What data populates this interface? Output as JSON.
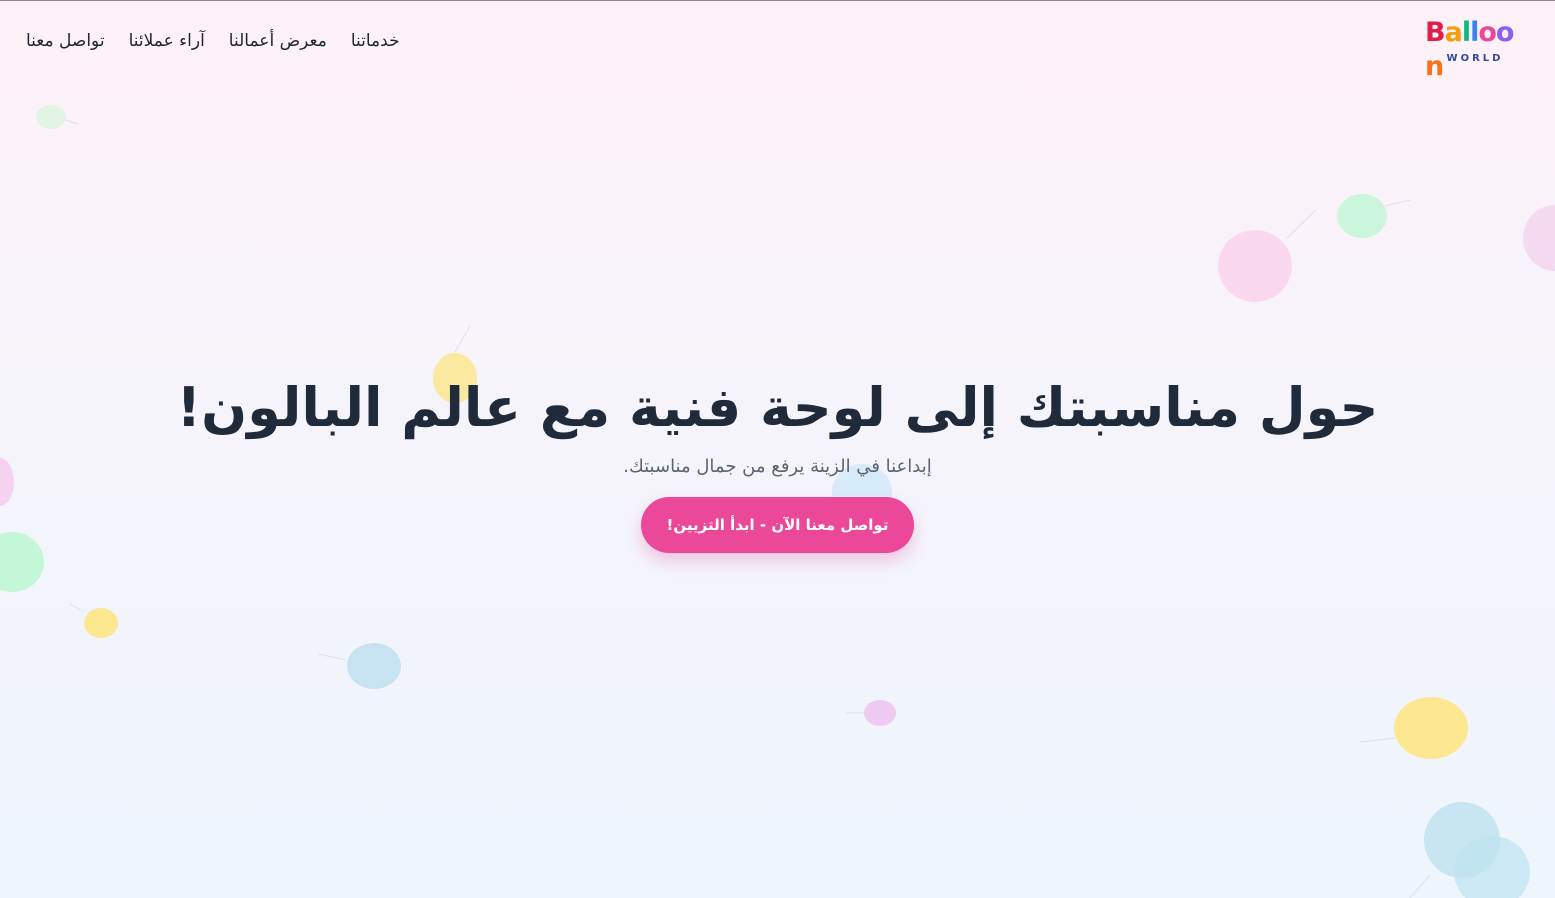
{
  "brand": {
    "logo_letters": [
      "B",
      "a",
      "l",
      "l",
      "o",
      "o",
      "n"
    ],
    "logo_colors": [
      "#e11d48",
      "#f59e0b",
      "#10b981",
      "#3b82f6",
      "#ec4899",
      "#8b5cf6",
      "#f97316"
    ],
    "logo_subtitle": "WORLD"
  },
  "nav": {
    "items": [
      {
        "label": "خدماتنا"
      },
      {
        "label": "معرض أعمالنا"
      },
      {
        "label": "آراء عملائنا"
      },
      {
        "label": "تواصل معنا"
      }
    ]
  },
  "hero": {
    "title": "حول مناسبتك إلى لوحة فنية مع عالم البالون!",
    "subtitle": "إبداعنا في الزينة يرفع من جمال مناسبتك.",
    "cta_label": "تواصل معنا الآن - ابدأ التزيين!"
  },
  "colors": {
    "accent": "#ec4899",
    "heading": "#1f2a3a",
    "text": "#5a6475"
  },
  "decorations": {
    "balloon_colors": [
      "#bbf7d0",
      "#fbcfe8",
      "#fde68a",
      "#bae6fd",
      "#e9d5ff"
    ]
  }
}
